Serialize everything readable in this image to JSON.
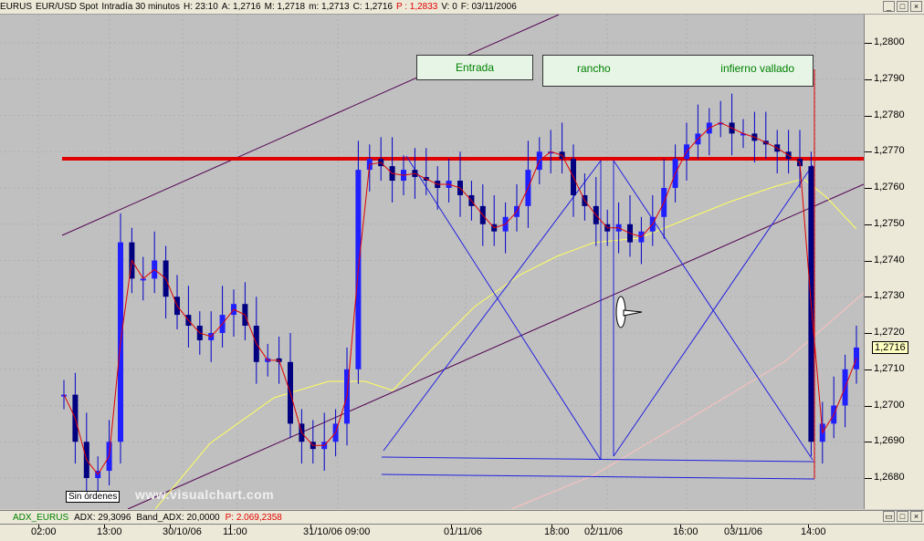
{
  "window": {
    "symbol": "EURUS",
    "description": "EUR/USD Spot",
    "timeframe": "Intradía 30 minutos",
    "high_label": "H: 23:10",
    "open_label": "A: 1,2716",
    "max_label": "M: 1,2718",
    "min_label": "m: 1,2713",
    "close_label": "C: 1,2716",
    "p_label": "P : 1,2833",
    "vol_label": "V: 0",
    "date_label": "F: 03/11/2006",
    "btn_min": "_",
    "btn_max": "□",
    "btn_close": "×"
  },
  "zones": {
    "entrada": "Entrada",
    "rancho": "rancho",
    "infierno": "infierno vallado"
  },
  "annotations": {
    "sin_ordenes": "Sin órdenes",
    "watermark": "www.visualchart.com"
  },
  "price_axis": {
    "labels": [
      "1,2800",
      "1,2790",
      "1,2780",
      "1,2770",
      "1,2760",
      "1,2750",
      "1,2740",
      "1,2730",
      "1,2720",
      "1,2710",
      "1,2700",
      "1,2690",
      "1,2680"
    ],
    "last_price": "1,2716"
  },
  "time_axis": {
    "labels": [
      "02:00",
      "13:00",
      "30/10/06",
      "11:00",
      "31/10/06 09:00",
      "01/11/06",
      "18:00",
      "02/11/06",
      "16:00",
      "03/11/06",
      "14:00"
    ]
  },
  "indicator": {
    "name": "ADX_EURUS",
    "adx": "ADX: 29,3096",
    "band": "Band_ADX: 20,0000",
    "p": "P: 2.069,2358",
    "btn_restore": "▭",
    "btn_max": "□",
    "btn_close": "×"
  },
  "colors": {
    "background": "#c0c0c0",
    "candles": "#0000c8",
    "red_line": "#e00000",
    "yellow_ma": "#ffff60",
    "pink_ma": "#ffc0c0",
    "channel": "#500050",
    "zone_text": "#008000"
  },
  "chart_data": {
    "type": "candlestick",
    "symbol": "EURUS",
    "ylim": [
      1.2675,
      1.2805
    ],
    "y_ticks": [
      1.28,
      1.279,
      1.278,
      1.277,
      1.276,
      1.275,
      1.274,
      1.273,
      1.272,
      1.271,
      1.27,
      1.269,
      1.268
    ],
    "horizontal_line": 1.2768,
    "last_price": 1.2716,
    "close_series": [
      1.2703,
      1.269,
      1.268,
      1.2682,
      1.269,
      1.2745,
      1.2735,
      1.2735,
      1.274,
      1.273,
      1.2725,
      1.2722,
      1.2718,
      1.272,
      1.2725,
      1.2728,
      1.2722,
      1.2712,
      1.2713,
      1.2712,
      1.2695,
      1.269,
      1.2688,
      1.269,
      1.2695,
      1.271,
      1.2765,
      1.2768,
      1.2766,
      1.2762,
      1.2765,
      1.2763,
      1.2762,
      1.276,
      1.2762,
      1.2758,
      1.2755,
      1.275,
      1.2748,
      1.2752,
      1.2755,
      1.2765,
      1.277,
      1.277,
      1.2768,
      1.2758,
      1.2755,
      1.275,
      1.2748,
      1.275,
      1.2745,
      1.2748,
      1.2752,
      1.276,
      1.2768,
      1.2772,
      1.2775,
      1.2778,
      1.2778,
      1.2775,
      1.2775,
      1.2773,
      1.2772,
      1.277,
      1.2768,
      1.2766,
      1.269,
      1.2695,
      1.27,
      1.271,
      1.2716
    ],
    "zones": [
      "Entrada",
      "rancho",
      "infierno vallado"
    ]
  }
}
